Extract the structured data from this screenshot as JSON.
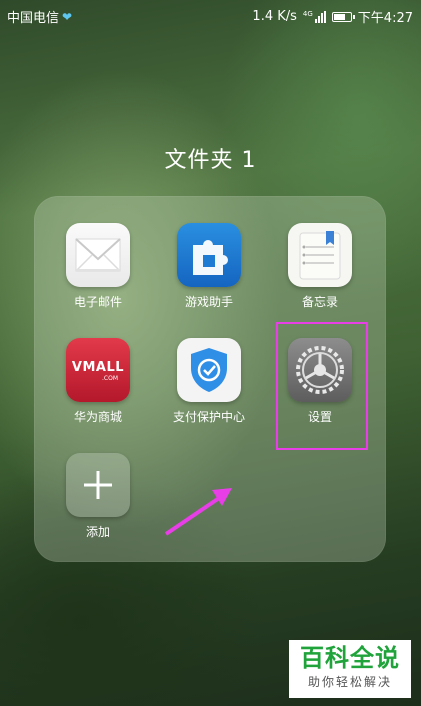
{
  "status_bar": {
    "carrier": "中国电信",
    "network_speed": "1.4 K/s",
    "network_type": "4G",
    "time": "下午4:27",
    "icons": [
      "heart-icon",
      "signal-icon",
      "battery-icon"
    ]
  },
  "folder": {
    "title": "文件夹 1",
    "apps": [
      {
        "label": "电子邮件",
        "icon": "mail-icon"
      },
      {
        "label": "游戏助手",
        "icon": "puzzle-icon"
      },
      {
        "label": "备忘录",
        "icon": "notepad-icon"
      },
      {
        "label": "华为商城",
        "icon": "vmall-icon",
        "icon_text": "VMALL",
        "icon_subtext": ".COM"
      },
      {
        "label": "支付保护中心",
        "icon": "shield-check-icon"
      },
      {
        "label": "设置",
        "icon": "gear-icon"
      }
    ],
    "add_label": "添加"
  },
  "annotations": {
    "highlight_color": "#e83ee8",
    "arrow_color": "#e83ee8"
  },
  "watermark": {
    "title": "百科全说",
    "subtitle": "助你轻松解决",
    "color": "#1fa33a"
  }
}
